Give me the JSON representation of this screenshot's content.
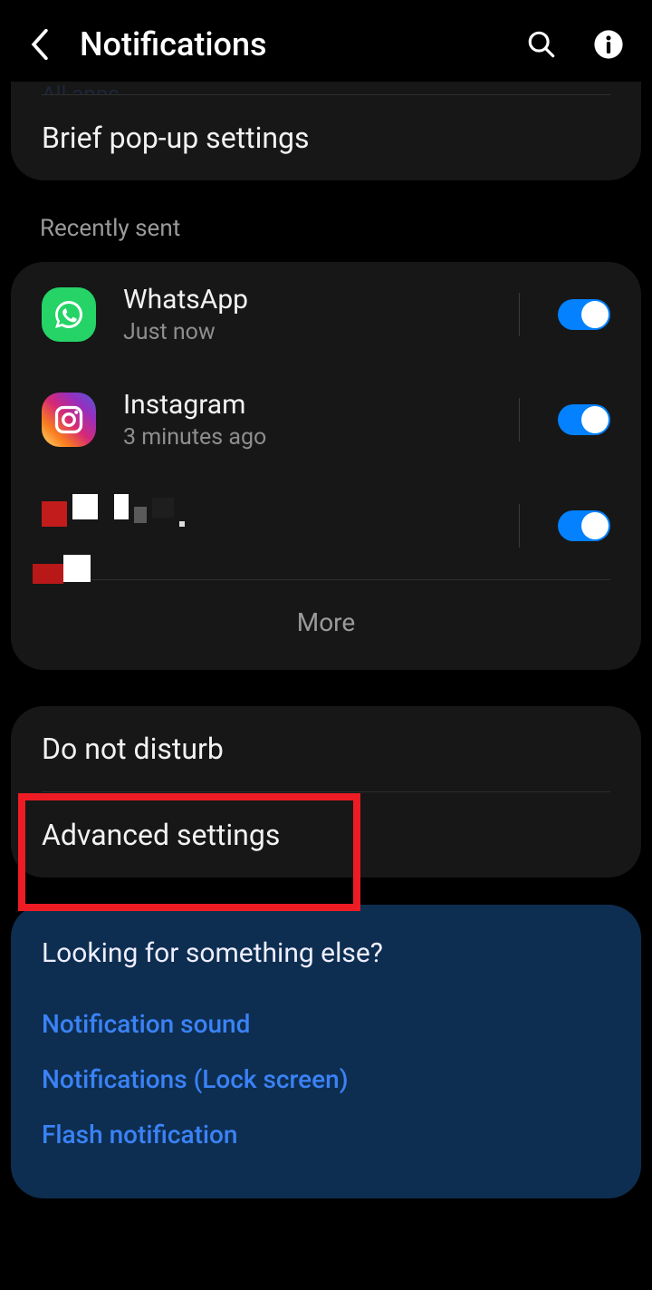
{
  "header": {
    "title": "Notifications"
  },
  "top_card": {
    "crumb": "All apps",
    "brief": "Brief pop-up settings"
  },
  "recent": {
    "label": "Recently sent",
    "apps": [
      {
        "name": "WhatsApp",
        "sub": "Just now"
      },
      {
        "name": "Instagram",
        "sub": "3 minutes ago"
      },
      {
        "name": "",
        "sub": ""
      }
    ],
    "more": "More"
  },
  "settings": {
    "dnd": "Do not disturb",
    "advanced": "Advanced settings"
  },
  "footer": {
    "title": "Looking for something else?",
    "links": [
      "Notification sound",
      "Notifications (Lock screen)",
      "Flash notification"
    ]
  }
}
